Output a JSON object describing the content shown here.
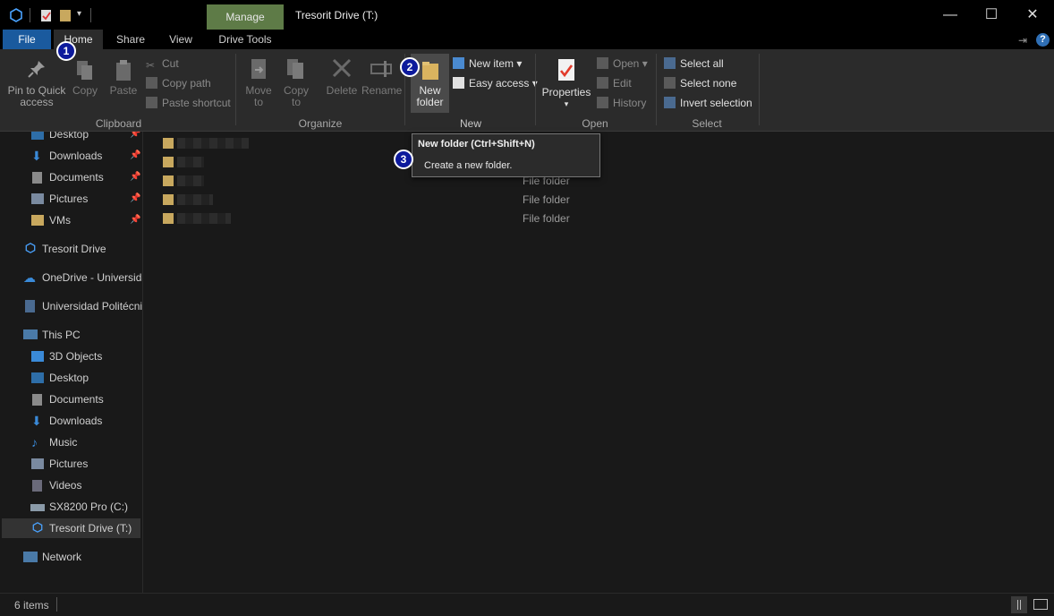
{
  "window": {
    "context_tab": "Manage",
    "title": "Tresorit Drive (T:)",
    "minimize": "—",
    "maximize": "☐",
    "close": "✕"
  },
  "tabs": {
    "file": "File",
    "home": "Home",
    "share": "Share",
    "view": "View",
    "drive_tools": "Drive Tools",
    "help": "?"
  },
  "ribbon": {
    "clipboard": {
      "pin": "Pin to Quick access",
      "pin_line1": "Pin to Quick",
      "pin_line2": "access",
      "copy": "Copy",
      "paste": "Paste",
      "cut": "Cut",
      "copy_path": "Copy path",
      "paste_shortcut": "Paste shortcut",
      "label": "Clipboard"
    },
    "organize": {
      "move_to": "Move",
      "move_to_2": "to",
      "copy_to": "Copy",
      "copy_to_2": "to",
      "delete": "Delete",
      "rename": "Rename",
      "label": "Organize"
    },
    "new": {
      "new_folder_1": "New",
      "new_folder_2": "folder",
      "new_item": "New item",
      "easy_access": "Easy access",
      "label": "New"
    },
    "open": {
      "properties": "Properties",
      "open": "Open",
      "edit": "Edit",
      "history": "History",
      "label": "Open"
    },
    "select": {
      "select_all": "Select all",
      "select_none": "Select none",
      "invert": "Invert selection",
      "label": "Select"
    }
  },
  "nav": {
    "quick_access": [
      "Desktop",
      "Downloads",
      "Documents",
      "Pictures",
      "VMs"
    ],
    "tresorit": "Tresorit Drive",
    "onedrive": "OneDrive - Universida",
    "university": "Universidad Politécni",
    "this_pc": "This PC",
    "pc_items": [
      "3D Objects",
      "Desktop",
      "Documents",
      "Downloads",
      "Music",
      "Pictures",
      "Videos",
      "SX8200 Pro (C:)",
      "Tresorit Drive (T:)"
    ],
    "network": "Network"
  },
  "files": {
    "type_label": "File folder"
  },
  "tooltip": {
    "title": "New folder (Ctrl+Shift+N)",
    "description": "Create a new folder."
  },
  "status": {
    "count": "6 items"
  },
  "badges": [
    "1",
    "2",
    "3"
  ],
  "colors": {
    "accent_file_tab": "#1a5a9e",
    "manage_tab": "#5e7b47",
    "badge": "#0d1a9c",
    "folder": "#c8a85e"
  }
}
